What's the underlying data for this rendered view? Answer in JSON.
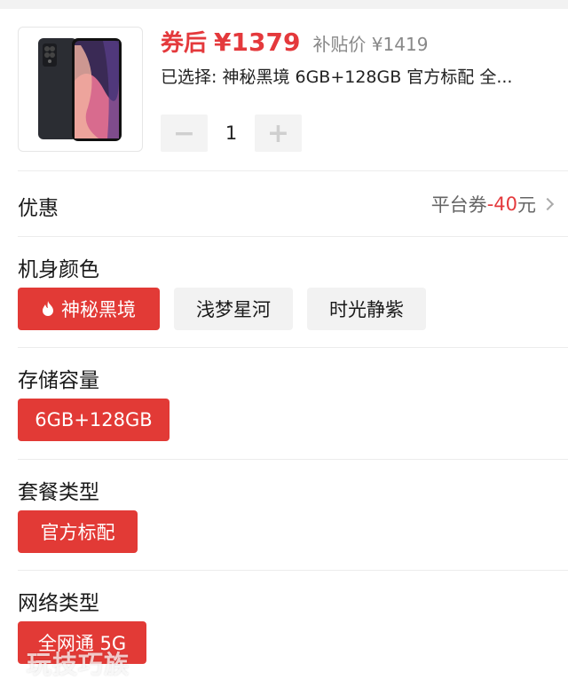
{
  "product": {
    "price_prefix": "券后",
    "price": "¥1379",
    "subsidy": "补贴价 ¥1419",
    "selected": "已选择: 神秘黑境 6GB+128GB 官方标配 全...",
    "quantity": "1",
    "minus_symbol": "−",
    "plus_symbol": "+"
  },
  "promo": {
    "label": "优惠",
    "coupon_text": "平台券",
    "amount": "-40",
    "unit": "元"
  },
  "color_section": {
    "title": "机身颜色",
    "options": [
      "神秘黑境",
      "浅梦星河",
      "时光静紫"
    ],
    "selected_index": 0
  },
  "storage_section": {
    "title": "存储容量",
    "options": [
      "6GB+128GB"
    ]
  },
  "package_section": {
    "title": "套餐类型",
    "options": [
      "官方标配"
    ]
  },
  "network_section": {
    "title": "网络类型",
    "options": [
      "全网通 5G"
    ]
  },
  "watermark": "玩技巧族",
  "colors": {
    "accent": "#e23a36",
    "price": "#e4393c",
    "chip_inactive": "#f2f2f2"
  }
}
